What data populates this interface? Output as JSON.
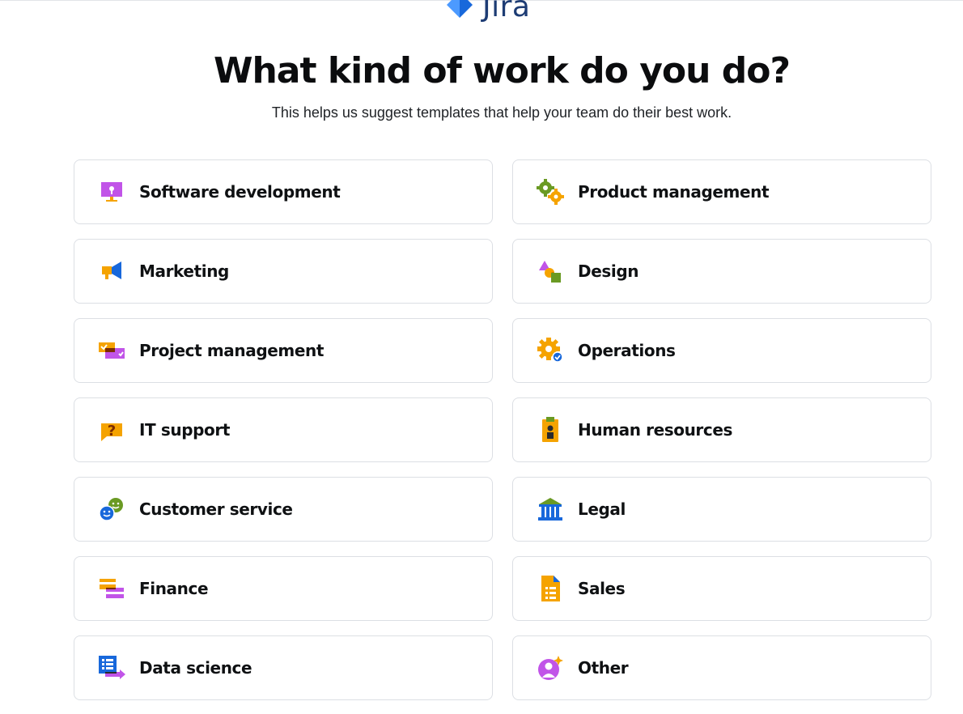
{
  "logo": {
    "text": "Jira",
    "icon": "jira-logo-icon"
  },
  "heading": "What kind of work do you do?",
  "subtitle": "This helps us suggest templates that help your team do their best work.",
  "options": [
    {
      "label": "Software development",
      "icon": "monitor-icon"
    },
    {
      "label": "Product management",
      "icon": "gears-icon"
    },
    {
      "label": "Marketing",
      "icon": "megaphone-icon"
    },
    {
      "label": "Design",
      "icon": "shapes-icon"
    },
    {
      "label": "Project management",
      "icon": "task-cards-icon"
    },
    {
      "label": "Operations",
      "icon": "gear-check-icon"
    },
    {
      "label": "IT support",
      "icon": "question-bubble-icon"
    },
    {
      "label": "Human resources",
      "icon": "id-badge-icon"
    },
    {
      "label": "Customer service",
      "icon": "smiley-faces-icon"
    },
    {
      "label": "Legal",
      "icon": "courthouse-icon"
    },
    {
      "label": "Finance",
      "icon": "credit-cards-icon"
    },
    {
      "label": "Sales",
      "icon": "document-icon"
    },
    {
      "label": "Data science",
      "icon": "data-chart-icon"
    },
    {
      "label": "Other",
      "icon": "person-sparkle-icon"
    }
  ],
  "colors": {
    "purple": "#c154e8",
    "orange": "#f5a300",
    "blue": "#1868db",
    "green": "#6a9a23",
    "dark": "#292a2e",
    "logo_blue": "#1d3c74"
  }
}
